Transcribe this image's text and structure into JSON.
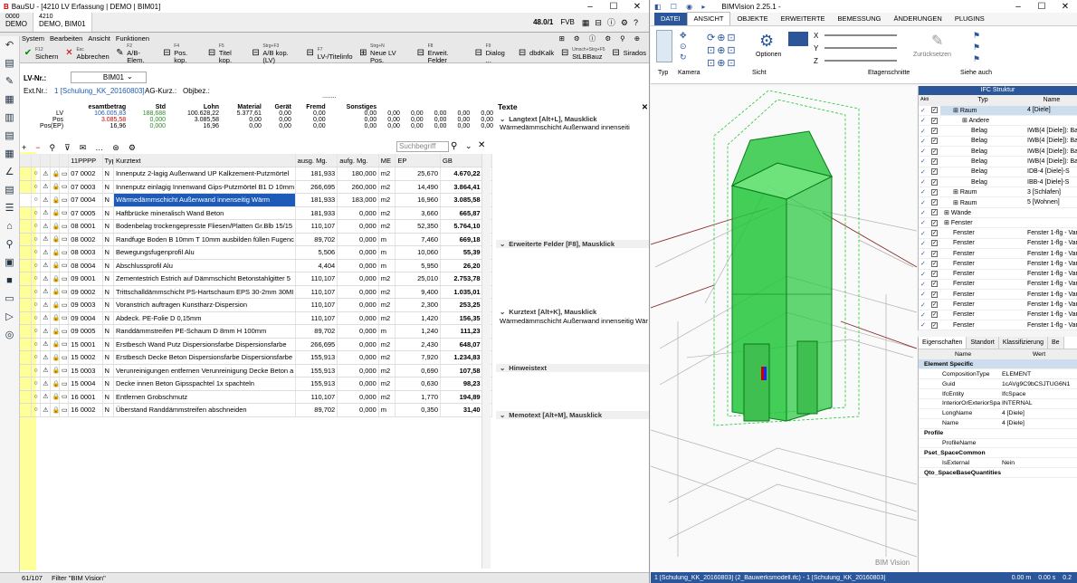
{
  "left": {
    "title": "BauSU - [4210 LV Erfassung | DEMO | BIM01]",
    "title_right": "48.0/1",
    "user": "FVB",
    "tabs": [
      {
        "code": "0000",
        "name": "DEMO"
      },
      {
        "code": "4210",
        "name": "DEMO, BIM01"
      }
    ],
    "menu": [
      "System",
      "Bearbeiten",
      "Ansicht",
      "Funktionen"
    ],
    "toolbar": [
      {
        "key": "F12",
        "label": "Sichern"
      },
      {
        "key": "Esc",
        "label": "Abbrechen"
      },
      {
        "key": "F2",
        "label": "A/B-Elem."
      },
      {
        "key": "F4",
        "label": "Pos. kop."
      },
      {
        "key": "F5",
        "label": "Titel kop."
      },
      {
        "key": "Strg+F3",
        "label": "A/B kop.(LV)"
      },
      {
        "key": "F7",
        "label": "LV-/Titelinfo"
      },
      {
        "key": "Strg+N",
        "label": "Neue LV Pos."
      },
      {
        "key": "F8",
        "label": "Erweit. Felder"
      },
      {
        "key": "F9",
        "label": "Dialog ..."
      },
      {
        "key": "",
        "label": "dbdKalk"
      },
      {
        "key": "Umsch+Strg+F5",
        "label": "StLBBauz"
      },
      {
        "key": "",
        "label": "Sirados"
      }
    ],
    "lv_label": "LV-Nr.:",
    "lv_value": "BIM01",
    "ext_label": "Ext.Nr.:",
    "ext_value": "1 [Schulung_KK_20160803]",
    "ag_label": "AG-Kurz.:",
    "obj_label": "Objbez.:",
    "sum_headers": [
      "esamtbetrag",
      "Std",
      "Lohn",
      "Material",
      "Gerät",
      "Fremd",
      "Sonstiges"
    ],
    "sum_rows": [
      {
        "label": "LV",
        "values": [
          "106.005,83",
          "188,688",
          "100.628,22",
          "5.377,61",
          "0,00",
          "0,00",
          "0,00",
          "0,00",
          "0,00",
          "0,00",
          "0,00",
          "0,00"
        ]
      },
      {
        "label": "Pos",
        "values": [
          "3.085,58",
          "0,000",
          "3.085,58",
          "0,00",
          "0,00",
          "0,00",
          "0,00",
          "0,00",
          "0,00",
          "0,00",
          "0,00",
          "0,00"
        ]
      },
      {
        "label": "Pos(EP)",
        "values": [
          "16,96",
          "0,000",
          "16,96",
          "0,00",
          "0,00",
          "0,00",
          "0,00",
          "0,00",
          "0,00",
          "0,00",
          "0,00",
          "0,00"
        ]
      }
    ],
    "search_placeholder": "Suchbegriff",
    "columns": [
      "11PPPP",
      "Typ",
      "Kurztext",
      "ausg. Mg.",
      "aufg. Mg.",
      "ME",
      "EP",
      "GB"
    ],
    "rows": [
      [
        "07 0002",
        "N",
        "Innenputz 2-lagig Außenwand UP Kalkzement-Putzmörtel",
        "181,933",
        "180,000",
        "m2",
        "25,670",
        "4.670,22"
      ],
      [
        "07 0003",
        "N",
        "Innenputz einlagig Innenwand Gips-Putzmörtel B1 D 10mm",
        "266,695",
        "260,000",
        "m2",
        "14,490",
        "3.864,41"
      ],
      [
        "07 0004",
        "N",
        "Wärmedämmschicht Außenwand innenseitig Wärm",
        "181,933",
        "183,000",
        "m2",
        "16,960",
        "3.085,58"
      ],
      [
        "07 0005",
        "N",
        "Haftbrücke mineralisch Wand Beton",
        "181,933",
        "0,000",
        "m2",
        "3,660",
        "665,87"
      ],
      [
        "08 0001",
        "N",
        "Bodenbelag trockengepresste Fliesen/Platten Gr.Blb 15/15",
        "110,107",
        "0,000",
        "m2",
        "52,350",
        "5.764,10"
      ],
      [
        "08 0002",
        "N",
        "Randfuge Boden B 10mm T 10mm ausbilden füllen Fugenc",
        "89,702",
        "0,000",
        "m",
        "7,460",
        "669,18"
      ],
      [
        "08 0003",
        "N",
        "Bewegungsfugenprofil Alu",
        "5,506",
        "0,000",
        "m",
        "10,060",
        "55,39"
      ],
      [
        "08 0004",
        "N",
        "Abschlussprofil Alu",
        "4,404",
        "0,000",
        "m",
        "5,950",
        "26,20"
      ],
      [
        "09 0001",
        "N",
        "Zementestrich Estrich auf Dämmschicht Betonstahlgitter 5",
        "110,107",
        "0,000",
        "m2",
        "25,010",
        "2.753,78"
      ],
      [
        "09 0002",
        "N",
        "Trittschalldämmschicht PS-Hartschaum EPS 30-2mm 30MI",
        "110,107",
        "0,000",
        "m2",
        "9,400",
        "1.035,01"
      ],
      [
        "09 0003",
        "N",
        "Voranstrich auftragen Kunstharz-Dispersion",
        "110,107",
        "0,000",
        "m2",
        "2,300",
        "253,25"
      ],
      [
        "09 0004",
        "N",
        "Abdeck. PE-Folie D 0,15mm",
        "110,107",
        "0,000",
        "m2",
        "1,420",
        "156,35"
      ],
      [
        "09 0005",
        "N",
        "Randdämmstreifen PE-Schaum D 8mm H 100mm",
        "89,702",
        "0,000",
        "m",
        "1,240",
        "111,23"
      ],
      [
        "15 0001",
        "N",
        "Erstbesch Wand Putz Dispersionsfarbe Dispersionsfarbe",
        "266,695",
        "0,000",
        "m2",
        "2,430",
        "648,07"
      ],
      [
        "15 0002",
        "N",
        "Erstbesch Decke Beton Dispersionsfarbe Dispersionsfarbe",
        "155,913",
        "0,000",
        "m2",
        "7,920",
        "1.234,83"
      ],
      [
        "15 0003",
        "N",
        "Verunreinigungen entfernen Verunreinigung Decke Beton a",
        "155,913",
        "0,000",
        "m2",
        "0,690",
        "107,58"
      ],
      [
        "15 0004",
        "N",
        "Decke innen Beton Gipsspachtel 1x spachteln",
        "155,913",
        "0,000",
        "m2",
        "0,630",
        "98,23"
      ],
      [
        "16 0001",
        "N",
        "Entfernen Grobschmutz",
        "110,107",
        "0,000",
        "m2",
        "1,770",
        "194,89"
      ],
      [
        "16 0002",
        "N",
        "Überstand Randdämmstreifen abschneiden",
        "89,702",
        "0,000",
        "m",
        "0,350",
        "31,40"
      ]
    ],
    "texte": {
      "title": "Texte",
      "langtext_label": "Langtext [Alt+L], Mausklick",
      "langtext_value": "Wärmedämmschicht Außenwand innenseiti",
      "erweitert_label": "Erweiterte Felder [F8], Mausklick",
      "kurztext_label": "Kurztext [Alt+K], Mausklick",
      "kurztext_value": "Wärmedämmschicht Außenwand innenseitig Wär",
      "hinweis_label": "Hinweistext",
      "memo_label": "Memotext [Alt+M], Mausklick"
    },
    "status_count": "61/107",
    "status_filter": "Filter \"BIM Vision\""
  },
  "right": {
    "title": "BIMVision 2.25.1 -",
    "ribbon_tabs": [
      "DATEI",
      "ANSICHT",
      "OBJEKTE",
      "ERWEITERTE",
      "BEMESSUNG",
      "ÄNDERUNGEN",
      "PLUGINS"
    ],
    "ribbon_active": "ANSICHT",
    "groups": [
      "Typ",
      "Kamera",
      "Sicht",
      "Etagenschnitte",
      "Siehe auch"
    ],
    "optionen": "Optionen",
    "zuruecksetzen": "Zurücksetzen",
    "axes": [
      "X",
      "Y",
      "Z"
    ],
    "ifc_title": "IFC Struktur",
    "ifc_cols": [
      "Akti v",
      "Typ",
      "Name"
    ],
    "ifc_rows": [
      {
        "typ": "Raum",
        "name": "4 [Diele]",
        "lvl": 1
      },
      {
        "typ": "Andere",
        "name": "",
        "lvl": 2
      },
      {
        "typ": "Belag",
        "name": "IWB(4 [Diele]): Basis",
        "lvl": 3
      },
      {
        "typ": "Belag",
        "name": "IWB(4 [Diele]): Basis",
        "lvl": 3
      },
      {
        "typ": "Belag",
        "name": "IWB(4 [Diele]): Basis",
        "lvl": 3
      },
      {
        "typ": "Belag",
        "name": "IWB(4 [Diele]): Basis",
        "lvl": 3
      },
      {
        "typ": "Belag",
        "name": "IDB-4 [Diele]-S",
        "lvl": 3
      },
      {
        "typ": "Belag",
        "name": "IBB-4 [Diele]-S",
        "lvl": 3
      },
      {
        "typ": "Raum",
        "name": "3 [Schlafen]",
        "lvl": 1
      },
      {
        "typ": "Raum",
        "name": "5 [Wohnen]",
        "lvl": 1
      },
      {
        "typ": "Wände",
        "name": "",
        "lvl": 0
      },
      {
        "typ": "Fenster",
        "name": "",
        "lvl": 0
      },
      {
        "typ": "Fenster",
        "name": "Fenster 1-flg - Varia",
        "lvl": 1
      },
      {
        "typ": "Fenster",
        "name": "Fenster 1-flg - Varia",
        "lvl": 1
      },
      {
        "typ": "Fenster",
        "name": "Fenster 1-flg - Varia",
        "lvl": 1
      },
      {
        "typ": "Fenster",
        "name": "Fenster 1-flg - Varia",
        "lvl": 1
      },
      {
        "typ": "Fenster",
        "name": "Fenster 1-flg - Varia",
        "lvl": 1
      },
      {
        "typ": "Fenster",
        "name": "Fenster 1-flg - Varia",
        "lvl": 1
      },
      {
        "typ": "Fenster",
        "name": "Fenster 1-flg - Varia",
        "lvl": 1
      },
      {
        "typ": "Fenster",
        "name": "Fenster 1-flg - Varia",
        "lvl": 1
      },
      {
        "typ": "Fenster",
        "name": "Fenster 1-flg - Varia",
        "lvl": 1
      },
      {
        "typ": "Fenster",
        "name": "Fenster 1-flg - Varia",
        "lvl": 1
      }
    ],
    "prop_tabs": [
      "Eigenschaften",
      "Standort",
      "Klassifizierung",
      "Be"
    ],
    "prop_cols": [
      "Name",
      "Wert"
    ],
    "props": [
      {
        "sec": true,
        "name": "Element Specific",
        "val": ""
      },
      {
        "name": "CompositionType",
        "val": "ELEMENT"
      },
      {
        "name": "Guid",
        "val": "1cAVg9C9bCSJTUG6N1"
      },
      {
        "name": "IfcEntity",
        "val": "IfcSpace"
      },
      {
        "name": "InteriorOrExteriorSpace",
        "val": "INTERNAL"
      },
      {
        "name": "LongName",
        "val": "4 [Diele]"
      },
      {
        "name": "Name",
        "val": "4 [Diele]"
      },
      {
        "sec": true,
        "name": "Profile",
        "val": ""
      },
      {
        "name": "ProfileName",
        "val": ""
      },
      {
        "sec": true,
        "name": "Pset_SpaceCommon",
        "val": ""
      },
      {
        "name": "IsExternal",
        "val": "Nein"
      },
      {
        "sec": true,
        "name": "Qto_SpaceBaseQuantities",
        "val": ""
      }
    ],
    "watermark": "BIM Vision",
    "status": "1 [Schulung_KK_20160803] (2_Bauwerksmodell.ifc) - 1 [Schulung_KK_20160803]",
    "status_right": [
      "0.00 m",
      "0.00 s",
      "0.2"
    ],
    "colors": {
      "green": "#22c63a",
      "accent": "#1e5bb8",
      "ribbon_blue": "#2b579a"
    }
  }
}
